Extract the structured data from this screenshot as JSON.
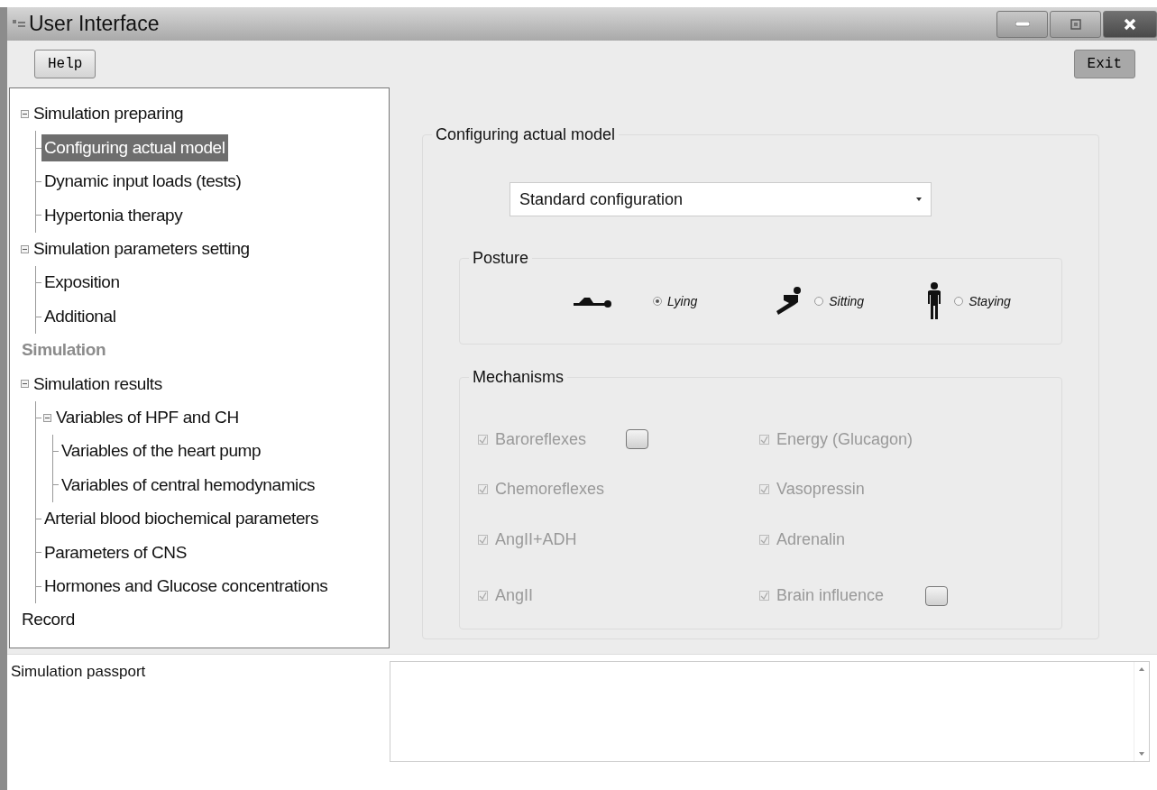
{
  "window": {
    "title": "User Interface"
  },
  "toolbar": {
    "help_button": "Help",
    "exit_button": "Exit"
  },
  "tree": [
    {
      "label": "Simulation preparing",
      "expanded": true,
      "selected": false,
      "disabled": false,
      "children": [
        {
          "label": "Configuring actual model",
          "selected": true,
          "disabled": false
        },
        {
          "label": "Dynamic input loads (tests)",
          "selected": false,
          "disabled": false
        },
        {
          "label": "Hypertonia therapy",
          "selected": false,
          "disabled": false
        }
      ]
    },
    {
      "label": "Simulation parameters setting",
      "expanded": true,
      "selected": false,
      "disabled": false,
      "children": [
        {
          "label": "Exposition",
          "selected": false,
          "disabled": false
        },
        {
          "label": "Additional",
          "selected": false,
          "disabled": false
        }
      ]
    },
    {
      "label": "Simulation",
      "selected": false,
      "disabled": true
    },
    {
      "label": "Simulation results",
      "expanded": true,
      "selected": false,
      "disabled": false,
      "children": [
        {
          "label": "Variables of HPF and CH",
          "expanded": true,
          "selected": false,
          "disabled": false,
          "children": [
            {
              "label": "Variables of the heart pump",
              "selected": false,
              "disabled": false
            },
            {
              "label": "Variables of central hemodynamics",
              "selected": false,
              "disabled": false
            }
          ]
        },
        {
          "label": "Arterial blood biochemical parameters",
          "selected": false,
          "disabled": false
        },
        {
          "label": "Parameters of CNS",
          "selected": false,
          "disabled": false
        },
        {
          "label": "Hormones and Glucose concentrations",
          "selected": false,
          "disabled": false
        }
      ]
    },
    {
      "label": "Record",
      "selected": false,
      "disabled": false
    }
  ],
  "config": {
    "title": "Configuring actual model",
    "dropdown": {
      "value": "Standard configuration"
    },
    "posture": {
      "title": "Posture",
      "options": [
        {
          "label": "Lying",
          "selected": true
        },
        {
          "label": "Sitting",
          "selected": false
        },
        {
          "label": "Staying",
          "selected": false
        }
      ]
    },
    "mechanisms": {
      "title": "Mechanisms",
      "items": [
        {
          "label": "Baroreflexes",
          "kind": "with_button",
          "checked": true,
          "disabled": true
        },
        {
          "label": "Energy (Glucagon)",
          "kind": "plain",
          "checked": true,
          "disabled": true
        },
        {
          "label": "Chemoreflexes",
          "kind": "plain",
          "checked": true,
          "disabled": true
        },
        {
          "label": "Vasopressin",
          "kind": "plain",
          "checked": true,
          "disabled": true
        },
        {
          "label": "AngII+ADH",
          "kind": "plain",
          "checked": true,
          "disabled": true
        },
        {
          "label": "Adrenalin",
          "kind": "plain",
          "checked": true,
          "disabled": true
        },
        {
          "label": "AngII",
          "kind": "plain",
          "checked": true,
          "disabled": true
        },
        {
          "label": "Brain influence",
          "kind": "with_button",
          "checked": true,
          "disabled": true
        }
      ]
    }
  },
  "passport": {
    "title": "Simulation passport"
  }
}
